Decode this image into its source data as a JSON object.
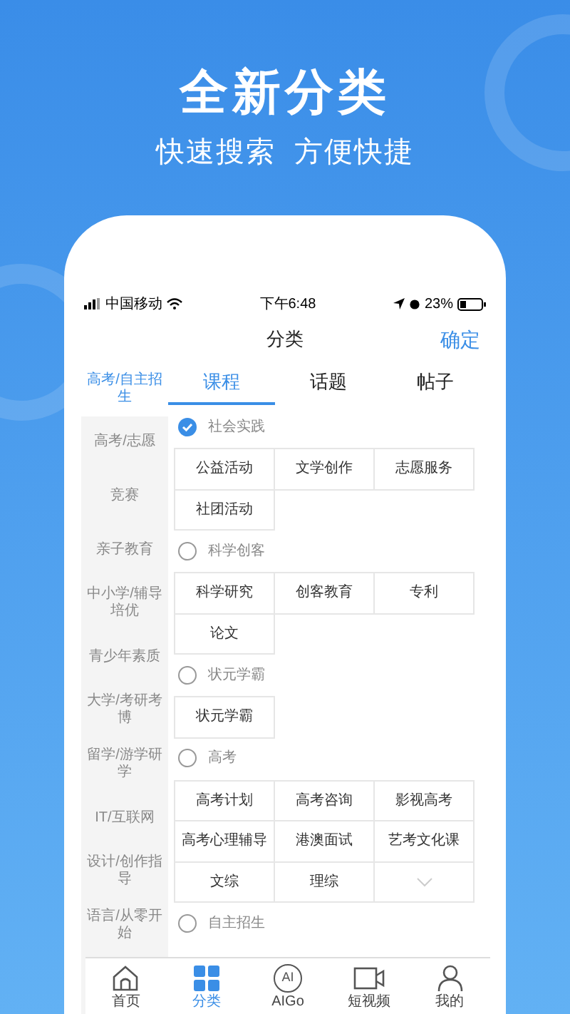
{
  "headline": "全新分类",
  "subtitle": "快速搜索  方便快捷",
  "status_bar": {
    "carrier": "中国移动",
    "time": "下午6:48",
    "battery": "23%"
  },
  "nav": {
    "title": "分类",
    "action": "确定"
  },
  "sidebar": {
    "items": [
      {
        "label": "高考/自主招生",
        "selected": true
      },
      {
        "label": "高考/志愿",
        "selected": false
      },
      {
        "label": "竞赛",
        "selected": false
      },
      {
        "label": "亲子教育",
        "selected": false
      },
      {
        "label": "中小学/辅导培优",
        "selected": false
      },
      {
        "label": "青少年素质",
        "selected": false
      },
      {
        "label": "大学/考研考博",
        "selected": false
      },
      {
        "label": "留学/游学研学",
        "selected": false
      },
      {
        "label": "IT/互联网",
        "selected": false
      },
      {
        "label": "设计/创作指导",
        "selected": false
      },
      {
        "label": "语言/从零开始",
        "selected": false
      }
    ]
  },
  "tabs": [
    {
      "label": "课程",
      "selected": true
    },
    {
      "label": "话题",
      "selected": false
    },
    {
      "label": "帖子",
      "selected": false
    }
  ],
  "categories": [
    {
      "label": "社会实践",
      "checked": true,
      "tags": [
        "公益活动",
        "文学创作",
        "志愿服务",
        "社团活动"
      ]
    },
    {
      "label": "科学创客",
      "checked": false,
      "tags": [
        "科学研究",
        "创客教育",
        "专利",
        "论文"
      ]
    },
    {
      "label": "状元学霸",
      "checked": false,
      "tags": [
        "状元学霸"
      ]
    },
    {
      "label": "高考",
      "checked": false,
      "tags": [
        "高考计划",
        "高考咨询",
        "影视高考",
        "高考心理辅导",
        "港澳面试",
        "艺考文化课",
        "文综",
        "理综"
      ],
      "collapsed": true
    },
    {
      "label": "自主招生",
      "checked": false
    }
  ],
  "bottom_tabs": [
    {
      "label": "首页",
      "kind": "home",
      "selected": false
    },
    {
      "label": "分类",
      "kind": "grid",
      "selected": true
    },
    {
      "label": "AIGo",
      "kind": "ai",
      "icon_text": "AI",
      "selected": false
    },
    {
      "label": "短视频",
      "kind": "video",
      "selected": false
    },
    {
      "label": "我的",
      "kind": "person",
      "selected": false
    }
  ]
}
